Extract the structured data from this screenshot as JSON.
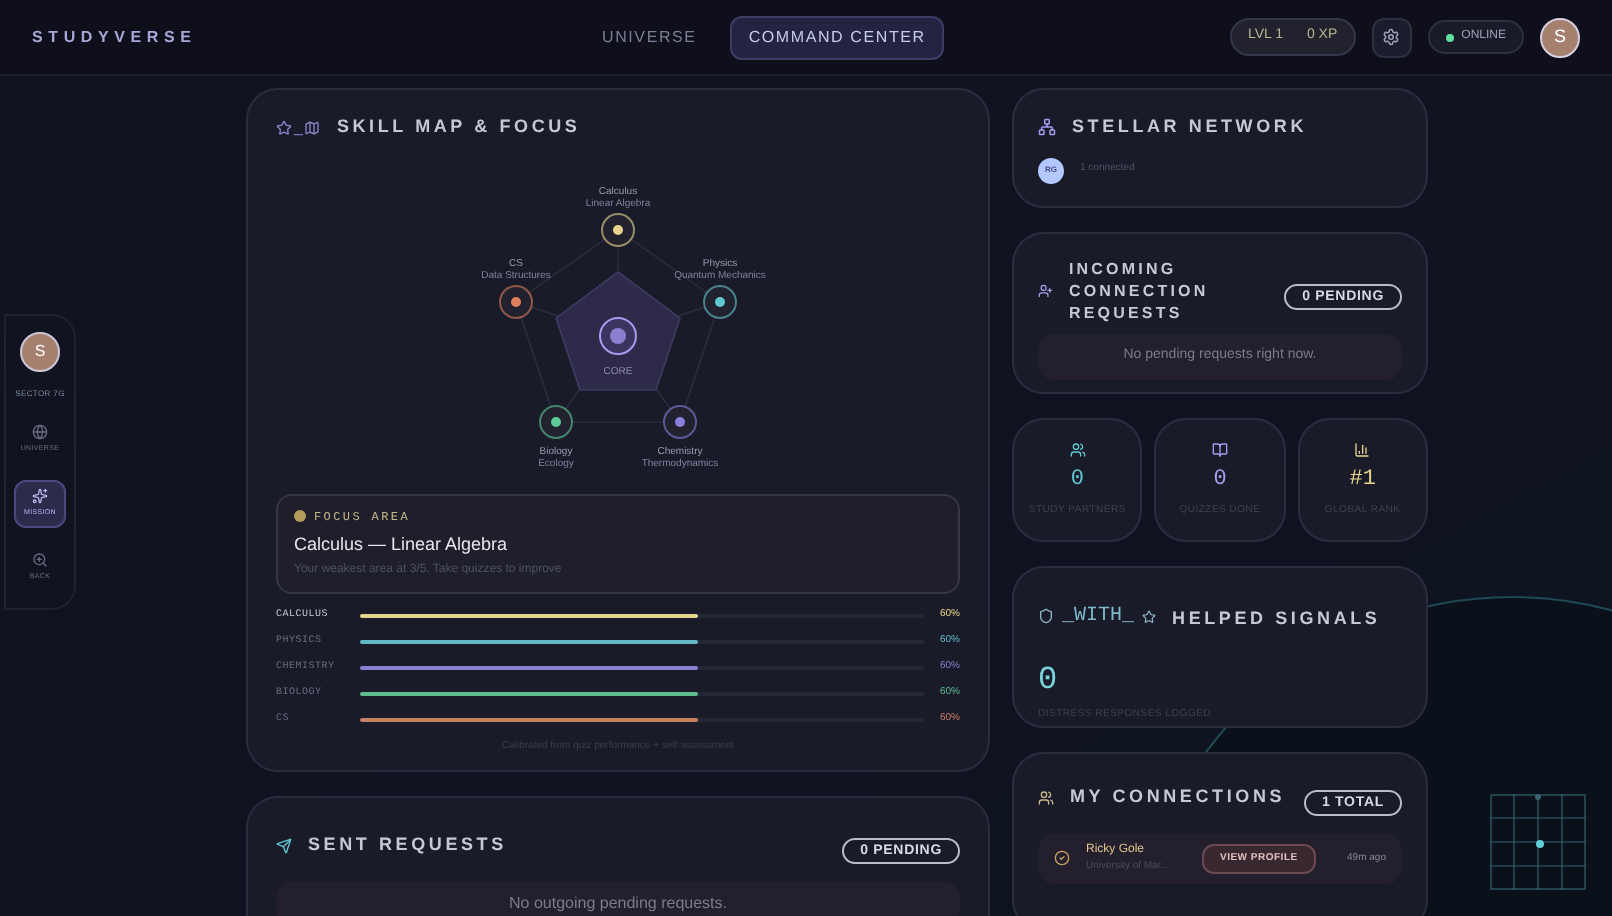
{
  "header": {
    "logo": "STUDYVERSE",
    "nav": [
      {
        "label": "UNIVERSE",
        "selected": false
      },
      {
        "label": "COMMAND CENTER",
        "selected": true
      }
    ],
    "level": "LVL 1",
    "xp": "0 XP",
    "status": "ONLINE",
    "avatar": "S"
  },
  "sidebar": {
    "avatar": "S",
    "sector": "SECTOR 7G",
    "items": [
      {
        "label": "UNIVERSE",
        "selected": false
      },
      {
        "label": "MISSION",
        "selected": true
      },
      {
        "label": "BACK",
        "selected": false
      }
    ]
  },
  "skill_map": {
    "title": "SKILL MAP & FOCUS",
    "icon_text": "_",
    "center": "CORE",
    "nodes": [
      {
        "name": "Calculus",
        "sub": "Linear Algebra",
        "color": "#e8d58a"
      },
      {
        "name": "CS",
        "sub": "Data Structures",
        "color": "#e07f5c"
      },
      {
        "name": "Physics",
        "sub": "Quantum Mechanics",
        "color": "#5fc8d0"
      },
      {
        "name": "Biology",
        "sub": "Ecology",
        "color": "#5dcb98"
      },
      {
        "name": "Chemistry",
        "sub": "Thermodynamics",
        "color": "#8b7fe0"
      }
    ],
    "focus": {
      "label": "FOCUS AREA",
      "title": "Calculus — Linear Algebra",
      "note": "Your weakest area at 3/5. Take quizzes to improve"
    },
    "skills": [
      {
        "name": "CALCULUS",
        "level": 0.6,
        "reading": "60%",
        "color": "#e8d58a"
      },
      {
        "name": "PHYSICS",
        "level": 0.6,
        "reading": "60%",
        "color": "#5fb8c4"
      },
      {
        "name": "CHEMISTRY",
        "level": 0.6,
        "reading": "60%",
        "color": "#8b7fd0"
      },
      {
        "name": "BIOLOGY",
        "level": 0.6,
        "reading": "60%",
        "color": "#5dbb8e"
      },
      {
        "name": "CS",
        "level": 0.6,
        "reading": "60%",
        "color": "#c77f62"
      }
    ],
    "footnote": "Calibrated from quiz performance + self-assessment"
  },
  "sent_requests": {
    "title": "SENT REQUESTS",
    "badge": "0 PENDING",
    "empty": "No outgoing pending requests."
  },
  "stellar_network": {
    "title": "STELLAR NETWORK",
    "avatar": "RG",
    "count": "1 connected"
  },
  "incoming": {
    "title": "INCOMING CONNECTION REQUESTS",
    "badge": "0 PENDING",
    "empty": "No pending requests right now."
  },
  "stats": [
    {
      "value": "0",
      "label": "STUDY PARTNERS",
      "color": "#5fc8d0"
    },
    {
      "value": "0",
      "label": "QUIZZES DONE",
      "color": "#a99cf0"
    },
    {
      "value": "#1",
      "label": "GLOBAL RANK",
      "color": "#e8d58a"
    }
  ],
  "helped": {
    "icon_text": "_WITH_",
    "title": "HELPED SIGNALS",
    "value": "0",
    "label": "DISTRESS RESPONSES LOGGED"
  },
  "connections": {
    "title": "MY CONNECTIONS",
    "badge": "1 TOTAL",
    "items": [
      {
        "name": "Ricky Gole",
        "school": "University of Mar...",
        "button": "VIEW PROFILE",
        "time": "49m ago"
      }
    ]
  }
}
